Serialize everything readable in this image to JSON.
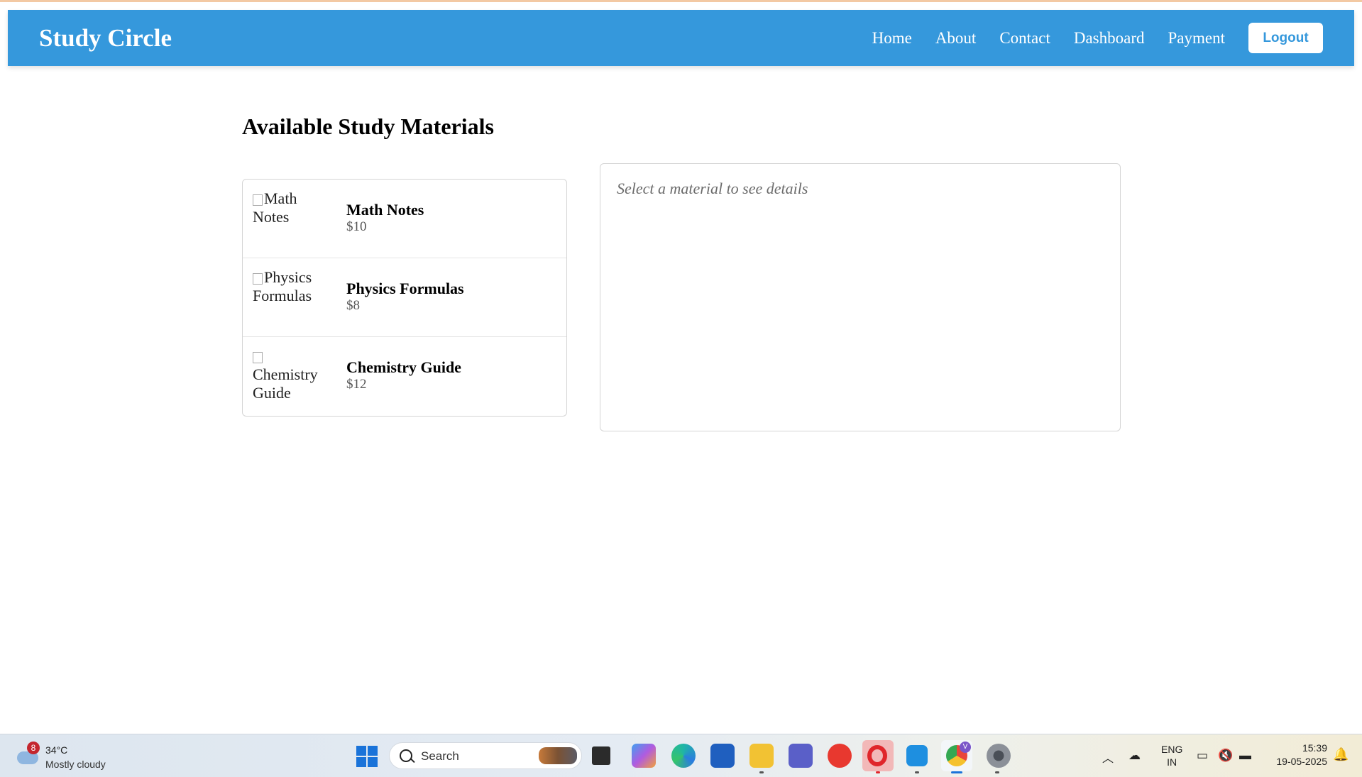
{
  "navbar": {
    "brand": "Study Circle",
    "links": [
      "Home",
      "About",
      "Contact",
      "Dashboard",
      "Payment"
    ],
    "logout_label": "Logout"
  },
  "main": {
    "title": "Available Study Materials",
    "materials": [
      {
        "alt": "Math Notes",
        "name": "Math Notes",
        "price": "$10"
      },
      {
        "alt": "Physics Formulas",
        "name": "Physics Formulas",
        "price": "$8"
      },
      {
        "alt": "Chemistry Guide",
        "name": "Chemistry Guide",
        "price": "$12"
      }
    ],
    "detail_placeholder": "Select a material to see details"
  },
  "taskbar": {
    "weather": {
      "badge": "8",
      "temp": "34°C",
      "condition": "Mostly cloudy"
    },
    "search_label": "Search",
    "apps": [
      "start-icon",
      "file-manager-icon",
      "copilot-icon",
      "edge-icon",
      "store-icon",
      "explorer-icon",
      "teams-icon",
      "wps-icon",
      "opera-icon",
      "vscode-icon",
      "chrome-icon",
      "settings-icon"
    ],
    "chrome_badge": "V",
    "lang": {
      "line1": "ENG",
      "line2": "IN"
    },
    "clock": {
      "time": "15:39",
      "date": "19-05-2025"
    }
  }
}
